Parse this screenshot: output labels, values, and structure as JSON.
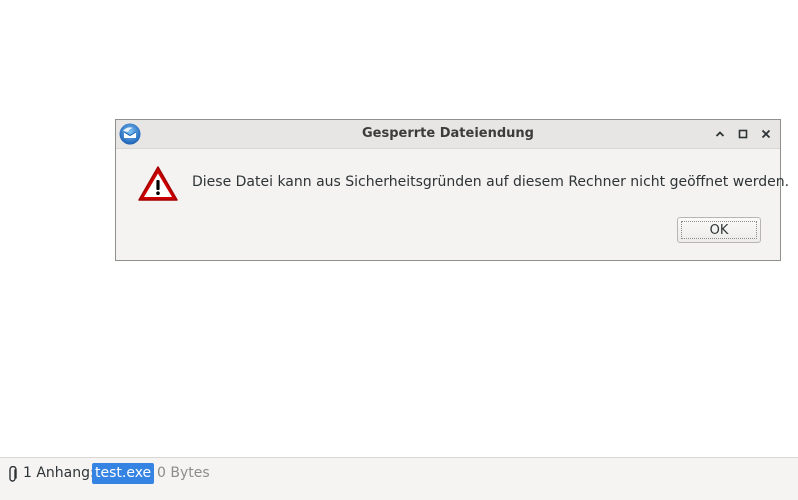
{
  "dialog": {
    "title": "Gesperrte Dateiendung",
    "message": "Diese Datei kann aus Sicherheitsgründen auf diesem Rechner nicht geöffnet werden.",
    "ok_label": "OK",
    "icons": {
      "app": "thunderbird-icon",
      "warning": "warning-icon",
      "minimize": "chevron-up-icon",
      "maximize": "maximize-icon",
      "close": "close-icon"
    }
  },
  "attachments": {
    "label": "1 Anhang:",
    "file_name": "test.exe",
    "file_size": "0 Bytes",
    "icon": "paperclip-icon"
  },
  "colors": {
    "selection": "#3584e4",
    "warning_red": "#cc0000"
  }
}
